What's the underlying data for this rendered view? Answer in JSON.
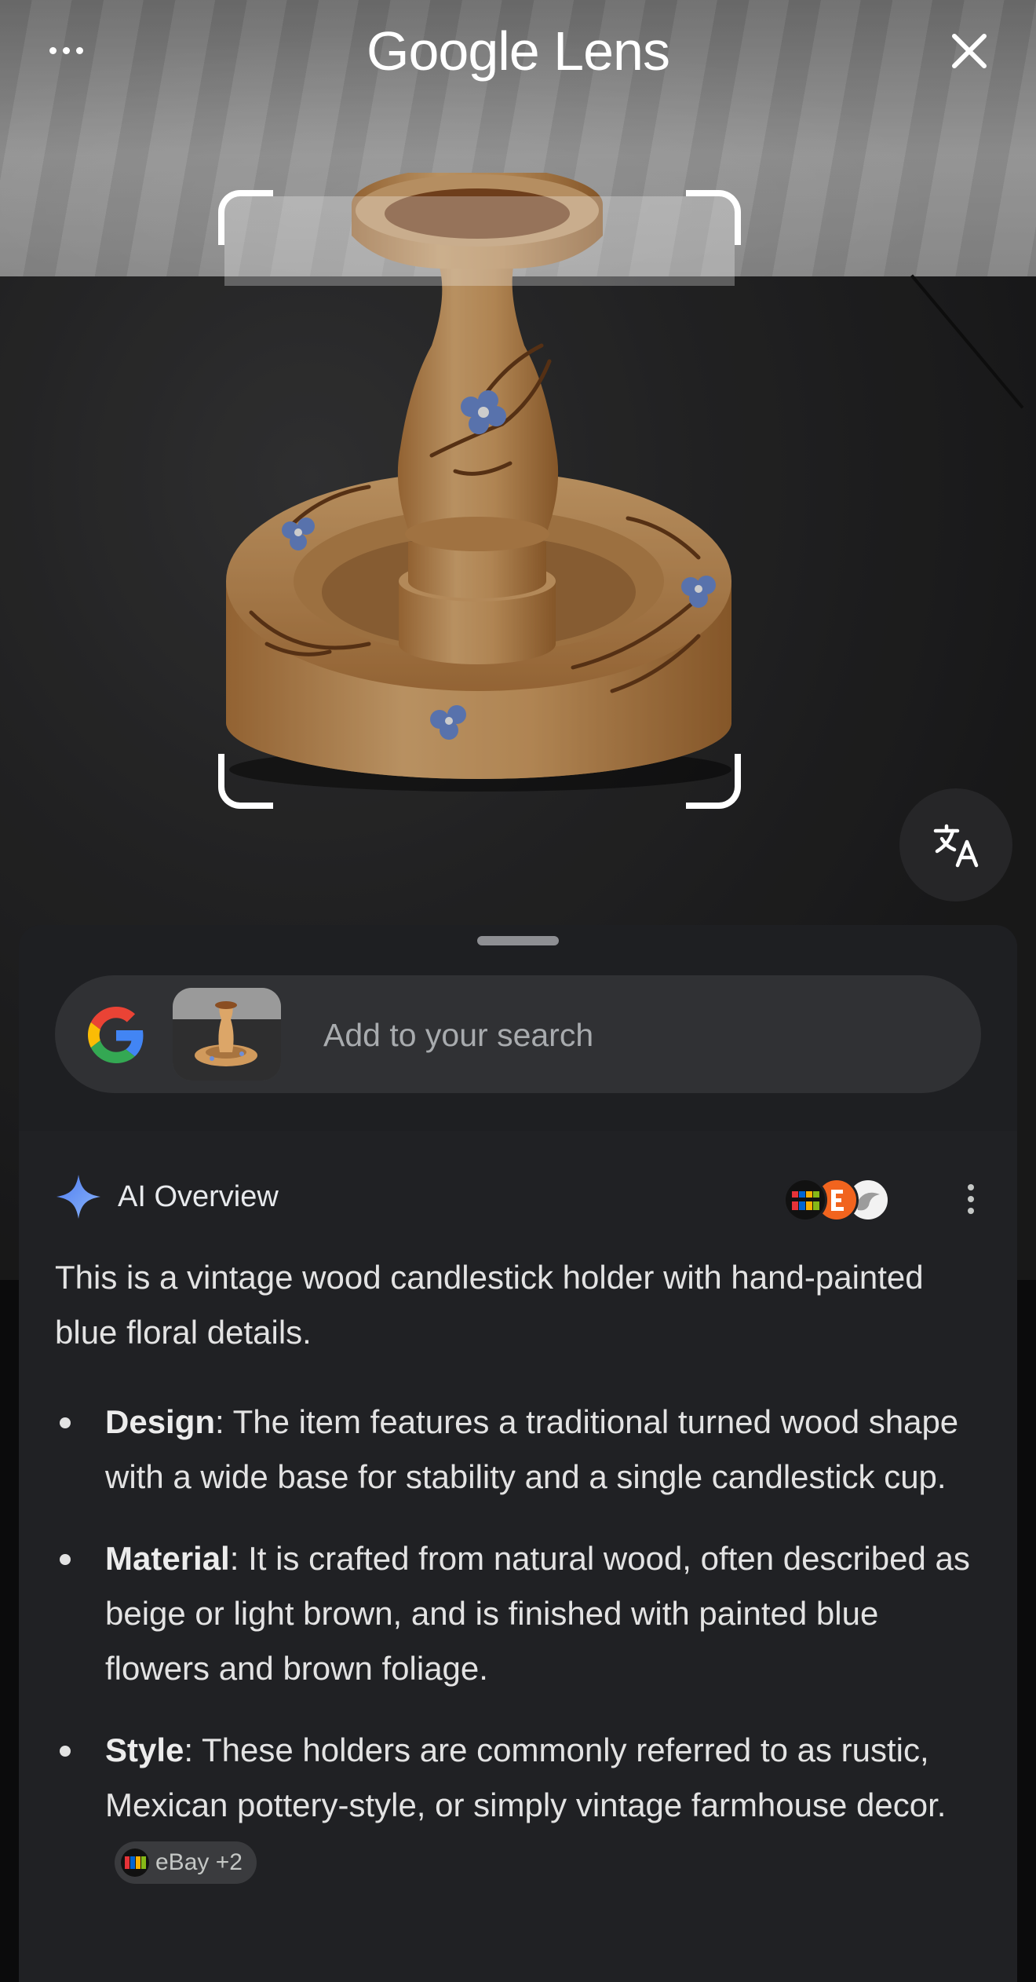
{
  "app": {
    "title": "Google Lens"
  },
  "icons": {
    "more": "more-horizontal-icon",
    "close": "close-icon",
    "translate": "translate-icon",
    "google": "google-g-icon",
    "spark": "ai-spark-icon",
    "overflow": "more-vertical-icon"
  },
  "search": {
    "placeholder": "Add to your search"
  },
  "ai_overview": {
    "title": "AI Overview",
    "summary": "This is a vintage wood candlestick holder with hand-painted blue floral details.",
    "bullets": [
      {
        "term": "Design",
        "text": ": The item features a traditional turned wood shape with a wide base for stability and a single candlestick cup."
      },
      {
        "term": "Material",
        "text": ": It is crafted from natural wood, often described as beige or light brown, and is finished with painted blue flowers and brown foliage."
      },
      {
        "term": "Style",
        "text": ": These holders are commonly referred to as rustic, Mexican pottery-style, or simply vintage farmhouse decor."
      }
    ],
    "source_chip": "eBay +2"
  },
  "colors": {
    "sheet_bg": "#202124",
    "search_bar": "#303134",
    "accent_blue": "#8ab4f8",
    "wood": "#d9a86a"
  }
}
